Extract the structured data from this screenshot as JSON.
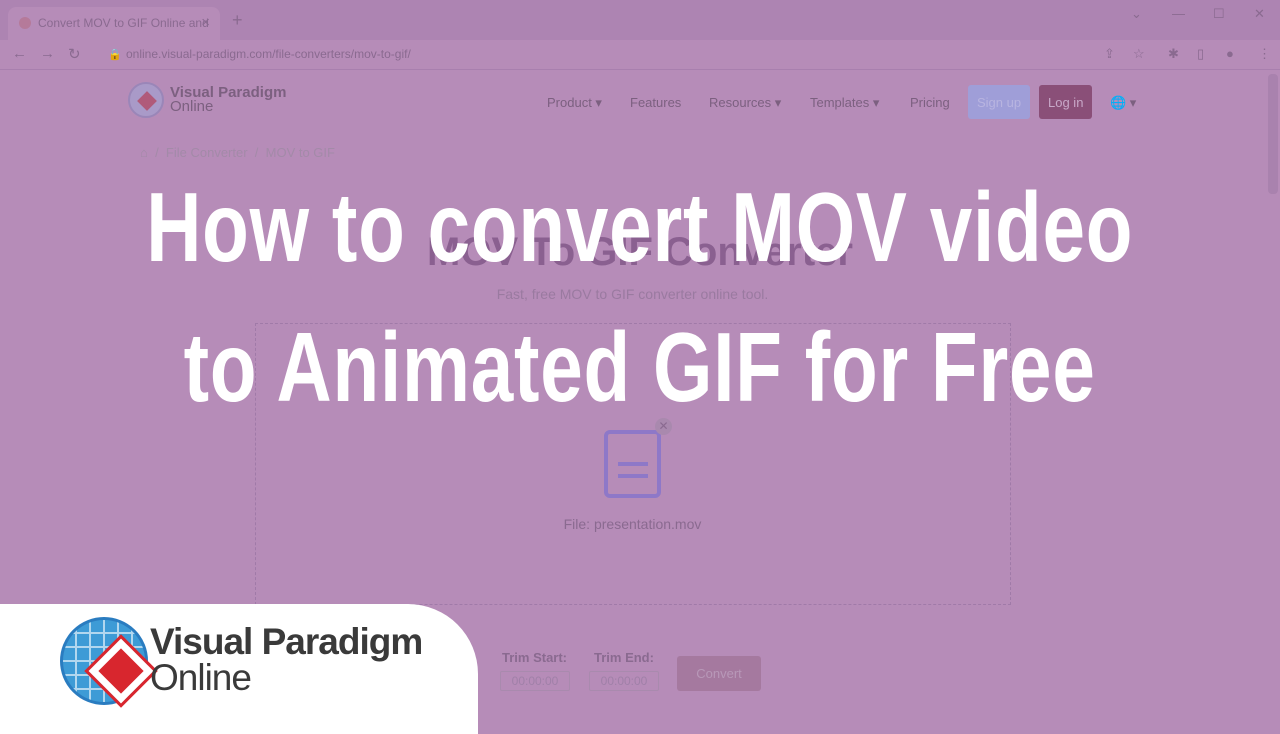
{
  "browser": {
    "tab_title": "Convert MOV to GIF Online and",
    "url": "online.visual-paradigm.com/file-converters/mov-to-gif/"
  },
  "site": {
    "logo_line1": "Visual Paradigm",
    "logo_line2": "Online",
    "menu": [
      "Product ▾",
      "Features",
      "Resources ▾",
      "Templates ▾",
      "Pricing"
    ],
    "signup": "Sign up",
    "login": "Log in",
    "lang": "🌐 ▾"
  },
  "breadcrumb": [
    "File Converter",
    "MOV to GIF"
  ],
  "page": {
    "heading": "MOV To GIF Converter",
    "subtitle": "Fast, free MOV to GIF converter online tool.",
    "file_label": "File: presentation.mov",
    "trim_start_label": "Trim Start:",
    "trim_end_label": "Trim End:",
    "trim_start": "00:00:00",
    "trim_end": "00:00:00",
    "convert": "Convert"
  },
  "overlay": {
    "title_line1": "How to convert MOV video",
    "title_line2": "to Animated GIF for Free"
  },
  "badge": {
    "line1": "Visual Paradigm",
    "line2": "Online"
  },
  "colors": {
    "tint": "#b68cb8",
    "signup": "#9f9ed8",
    "login": "#8a4f78",
    "logo_red": "#d8262e",
    "logo_blue": "#3d9bd6"
  }
}
